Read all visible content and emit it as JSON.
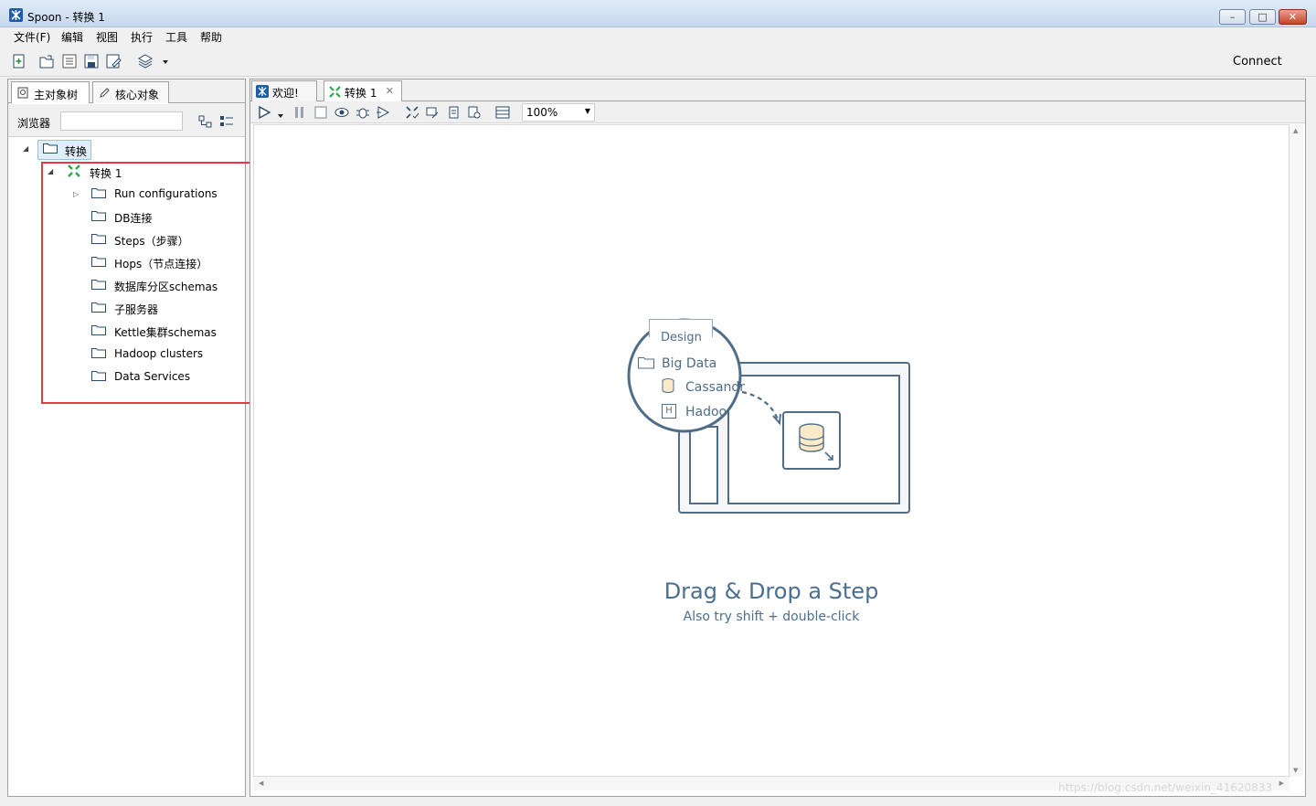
{
  "window": {
    "title": "Spoon - 转换 1",
    "controls": {
      "minimize": "–",
      "maximize": "□",
      "close": "✕"
    }
  },
  "menu": [
    "文件(F)",
    "编辑",
    "视图",
    "执行",
    "工具",
    "帮助"
  ],
  "toolbar": {
    "icons": [
      "new-file-icon",
      "open-icon",
      "explore-repository-icon",
      "save-icon",
      "save-as-icon",
      "layers-icon",
      "dropdown-arrow-icon"
    ],
    "connect_label": "Connect"
  },
  "left_panel": {
    "tabs": [
      "主对象树",
      "核心对象"
    ],
    "browser_label": "浏览器",
    "search_value": "",
    "tree": {
      "root": "转换",
      "transformation": "转换 1",
      "children": [
        "Run configurations",
        "DB连接",
        "Steps（步骤）",
        "Hops（节点连接）",
        "数据库分区schemas",
        "子服务器",
        "Kettle集群schemas",
        "Hadoop clusters",
        "Data Services"
      ]
    }
  },
  "right_panel": {
    "tabs": [
      "欢迎!",
      "转换 1"
    ],
    "zoom": "100%",
    "illustration": {
      "design_tab": "Design",
      "folder": "Big Data",
      "item1": "Cassandr",
      "item2": "Hadoo",
      "hadoop_badge": "H"
    },
    "drag_title": "Drag & Drop a Step",
    "drag_subtitle": "Also try shift + double-click"
  },
  "watermark": "https://blog.csdn.net/weixin_41620833",
  "colors": {
    "highlight_box": "#e03a45",
    "accent_text": "#4a6f8f",
    "selection": "#dfeefc"
  }
}
